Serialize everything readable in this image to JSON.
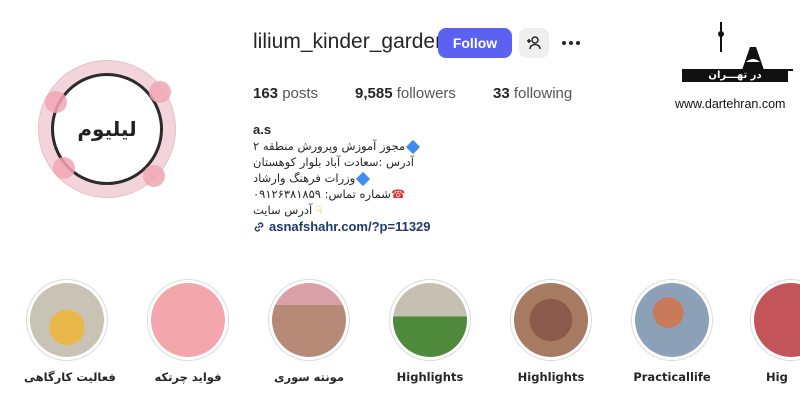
{
  "profile": {
    "username": "lilium_kinder_garden",
    "avatar_text": "لیلیوم",
    "follow_label": "Follow",
    "posts_count": "163",
    "posts_label": "posts",
    "followers_count": "9,585",
    "followers_label": "followers",
    "following_count": "33",
    "following_label": "following"
  },
  "bio": {
    "name": "a.s",
    "line1": "مجوز آموزش وپرورش منطقه ۲",
    "line2": "آدرس :سعادت آباد بلوار کوهستان",
    "line3": "وزرات فرهنگ وارشاد",
    "line4": "شماره تماس: ۰۹۱۲۶۳۸۱۸۵۹",
    "line5": "آدرس سایت",
    "link": "asnafshahr.com/?p=11329"
  },
  "watermark": {
    "brand": "در تهـــران",
    "url": "www.dartehran.com"
  },
  "highlights": [
    {
      "label": "فعالیت کارگاهی"
    },
    {
      "label": "فواید چرتکه"
    },
    {
      "label": "مونته سوری"
    },
    {
      "label": "Highlights"
    },
    {
      "label": "Highlights"
    },
    {
      "label": "Practicallife"
    },
    {
      "label": "Hig"
    }
  ],
  "icons": {
    "add_user": "add-user-icon",
    "more": "more-options-icon",
    "link": "link-icon",
    "diamond": "blue-diamond-icon",
    "phone": "telephone-icon",
    "pointing": "pointing-down-hand-icon"
  },
  "colors": {
    "follow": "#5b61f0",
    "link": "#1f3a6b",
    "diamond": "#3c8ef0"
  }
}
